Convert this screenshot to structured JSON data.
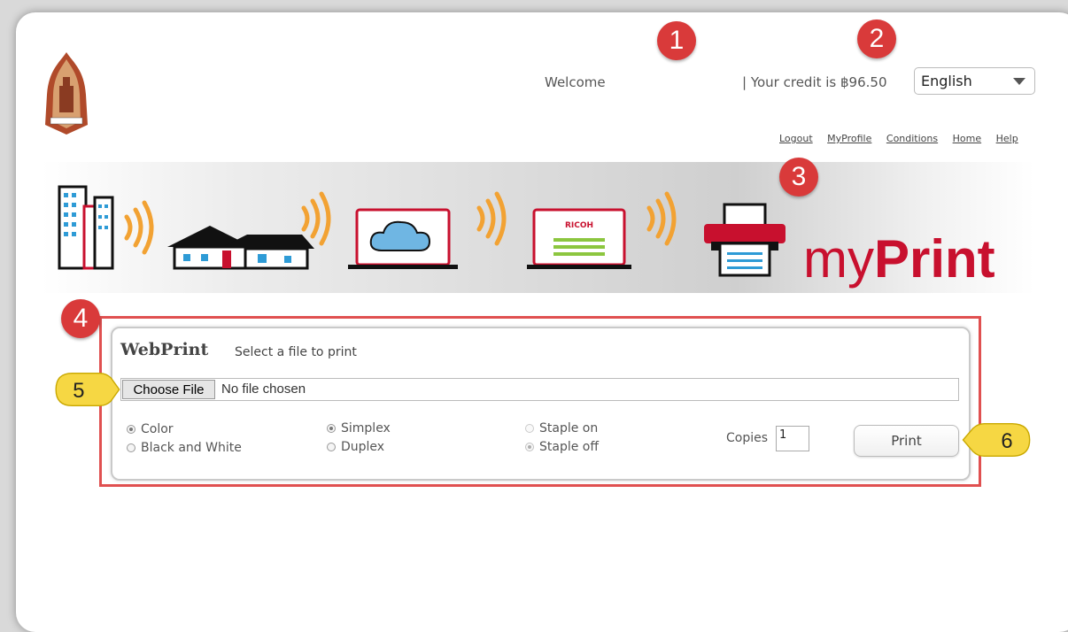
{
  "header": {
    "welcome": "Welcome",
    "credit": "| Your credit is ฿96.50",
    "language": {
      "selected": "English"
    }
  },
  "nav": {
    "links": [
      "Logout",
      "MyProfile",
      "Conditions",
      "Home",
      "Help"
    ]
  },
  "banner": {
    "brand_prefix": "my",
    "brand_bold": "Print",
    "laptop_label": "RICOH"
  },
  "webprint": {
    "title": "WebPrint",
    "subtitle": "Select a file to print",
    "choose_file": "Choose File",
    "no_file": "No file chosen",
    "color_options": [
      {
        "label": "Color",
        "selected": true
      },
      {
        "label": "Black and White",
        "selected": false
      }
    ],
    "sides_options": [
      {
        "label": "Simplex",
        "selected": true
      },
      {
        "label": "Duplex",
        "selected": false
      }
    ],
    "staple_options": [
      {
        "label": "Staple on",
        "selected": false
      },
      {
        "label": "Staple off",
        "selected": true
      }
    ],
    "copies_label": "Copies",
    "copies_value": "1",
    "print_label": "Print"
  },
  "annotations": {
    "badges": [
      "1",
      "2",
      "3",
      "4",
      "5",
      "6"
    ]
  },
  "colors": {
    "brand_red": "#c8102e",
    "badge_red": "#d93a3a",
    "callout_yellow": "#f6d743",
    "banner_orange": "#f2a233"
  }
}
